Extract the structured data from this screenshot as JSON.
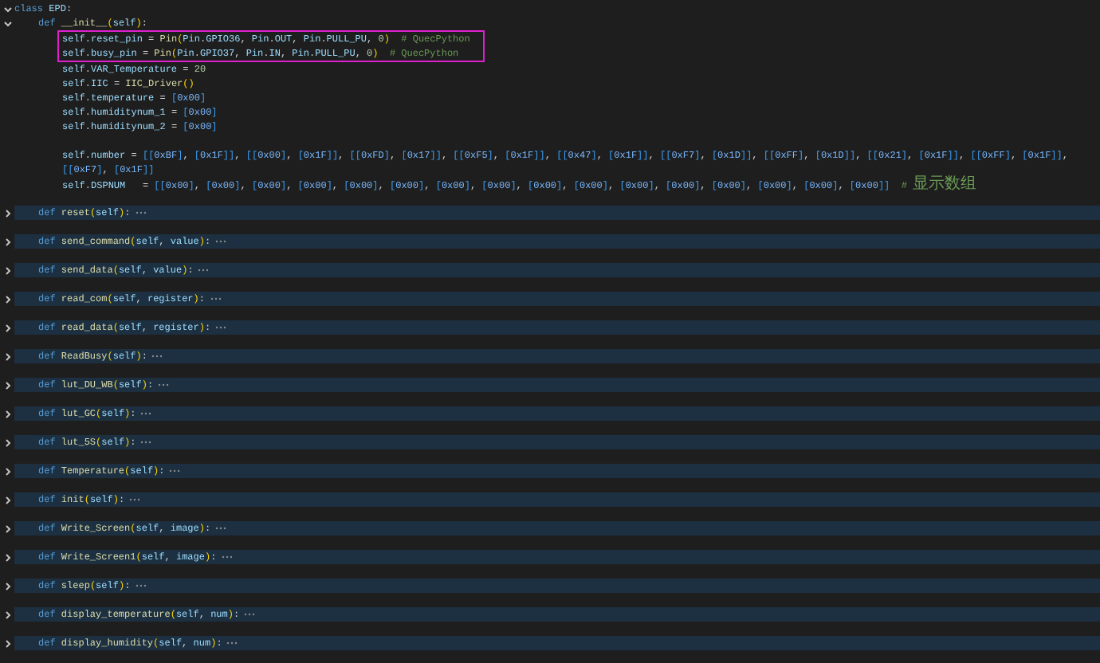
{
  "code": [
    {
      "kind": "line",
      "text": "class EPD:",
      "expanded": true,
      "children": [
        {
          "kind": "line",
          "text": "def __init__(self):",
          "expanded": true,
          "children": [
            {
              "kind": "boxed",
              "lines": [
                {
                  "kind": "line",
                  "text": "self.reset_pin = Pin(Pin.GPIO36, Pin.OUT, Pin.PULL_PU, 0)  # QuecPython"
                },
                {
                  "kind": "line",
                  "text": "self.busy_pin = Pin(Pin.GPIO37, Pin.IN, Pin.PULL_PU, 0)  # QuecPython"
                }
              ]
            },
            {
              "kind": "line",
              "text": "self.VAR_Temperature = 20"
            },
            {
              "kind": "line",
              "text": "self.IIC = IIC_Driver()"
            },
            {
              "kind": "line",
              "text": "self.temperature = [0x00]"
            },
            {
              "kind": "line",
              "text": "self.humiditynum_1 = [0x00]"
            },
            {
              "kind": "line",
              "text": "self.humiditynum_2 = [0x00]"
            },
            {
              "kind": "blank"
            },
            {
              "kind": "line",
              "text": "self.number = [[0xBF], [0x1F]], [[0x00], [0x1F]], [[0xFD], [0x17]], [[0xF5], [0x1F]], [[0x47], [0x1F]], [[0xF7], [0x1D]], [[0xFF], [0x1D]], [[0x21], [0x1F]], [[0xFF], [0x1F]],"
            },
            {
              "kind": "continuation",
              "text": "[[0xF7], [0x1F]]"
            },
            {
              "kind": "line",
              "text": "self.DSPNUM   = [[0x00], [0x00], [0x00], [0x00], [0x00], [0x00], [0x00], [0x00], [0x00], [0x00], [0x00], [0x00], [0x00], [0x00], [0x00], [0x00]]  # 显示数组"
            },
            {
              "kind": "blank"
            }
          ]
        },
        {
          "kind": "line",
          "text": "def reset(self):",
          "expanded": false
        },
        {
          "kind": "blank"
        },
        {
          "kind": "line",
          "text": "def send_command(self, value):",
          "expanded": false
        },
        {
          "kind": "blank"
        },
        {
          "kind": "line",
          "text": "def send_data(self, value):",
          "expanded": false
        },
        {
          "kind": "blank"
        },
        {
          "kind": "line",
          "text": "def read_com(self, register):",
          "expanded": false
        },
        {
          "kind": "blank"
        },
        {
          "kind": "line",
          "text": "def read_data(self, register):",
          "expanded": false
        },
        {
          "kind": "blank"
        },
        {
          "kind": "line",
          "text": "def ReadBusy(self):",
          "expanded": false
        },
        {
          "kind": "blank"
        },
        {
          "kind": "line",
          "text": "def lut_DU_WB(self):",
          "expanded": false
        },
        {
          "kind": "blank"
        },
        {
          "kind": "line",
          "text": "def lut_GC(self):",
          "expanded": false
        },
        {
          "kind": "blank"
        },
        {
          "kind": "line",
          "text": "def lut_5S(self):",
          "expanded": false
        },
        {
          "kind": "blank"
        },
        {
          "kind": "line",
          "text": "def Temperature(self):",
          "expanded": false
        },
        {
          "kind": "blank"
        },
        {
          "kind": "line",
          "text": "def init(self):",
          "expanded": false
        },
        {
          "kind": "blank"
        },
        {
          "kind": "line",
          "text": "def Write_Screen(self, image):",
          "expanded": false
        },
        {
          "kind": "blank"
        },
        {
          "kind": "line",
          "text": "def Write_Screen1(self, image):",
          "expanded": false
        },
        {
          "kind": "blank"
        },
        {
          "kind": "line",
          "text": "def sleep(self):",
          "expanded": false
        },
        {
          "kind": "blank"
        },
        {
          "kind": "line",
          "text": "def display_temperature(self, num):",
          "expanded": false
        },
        {
          "kind": "blank"
        },
        {
          "kind": "line",
          "text": "def display_humidity(self, num):",
          "expanded": false
        }
      ]
    }
  ]
}
